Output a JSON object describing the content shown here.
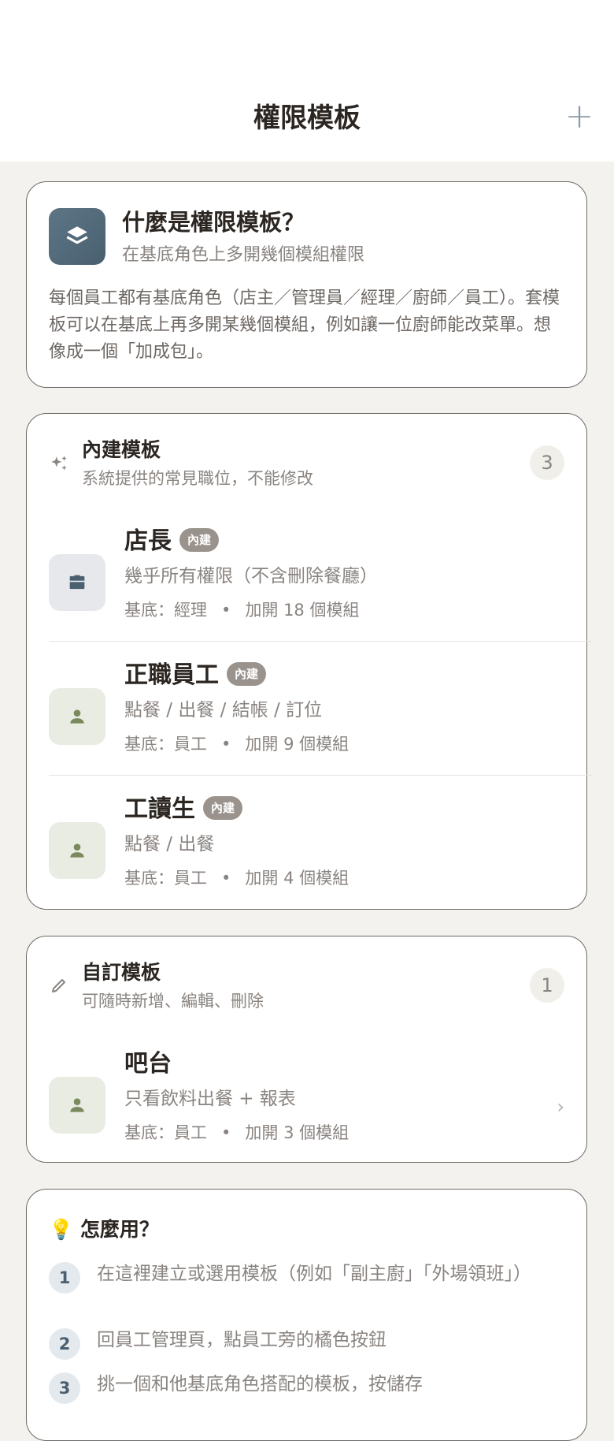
{
  "header": {
    "title": "權限模板",
    "add_icon": "plus-icon"
  },
  "intro": {
    "icon": "layers-icon",
    "title": "什麼是權限模板？",
    "subtitle": "在基底角色上多開幾個模組權限",
    "body": "每個員工都有基底角色（店主／管理員／經理／廚師／員工）。套模板可以在基底上再多開某幾個模組，例如讓一位廚師能改菜單。想像成一個「加成包」。"
  },
  "builtin": {
    "icon": "sparkle-icon",
    "title": "內建模板",
    "subtitle": "系統提供的常見職位，不能修改",
    "count": "3",
    "items": [
      {
        "icon": "briefcase-icon",
        "name": "店長",
        "badge": "內建",
        "desc": "幾乎所有權限（不含刪除餐廳）",
        "base": "基底：經理",
        "dot": "•",
        "extra": "加開 18 個模組"
      },
      {
        "icon": "person-icon",
        "name": "正職員工",
        "badge": "內建",
        "desc": "點餐 / 出餐 / 結帳 / 訂位",
        "base": "基底：員工",
        "dot": "•",
        "extra": "加開 9 個模組"
      },
      {
        "icon": "person-icon",
        "name": "工讀生",
        "badge": "內建",
        "desc": "點餐 / 出餐",
        "base": "基底：員工",
        "dot": "•",
        "extra": "加開 4 個模組"
      }
    ]
  },
  "custom": {
    "icon": "pencil-icon",
    "title": "自訂模板",
    "subtitle": "可隨時新增、編輯、刪除",
    "count": "1",
    "items": [
      {
        "icon": "person-icon",
        "name": "吧台",
        "desc": "只看飲料出餐 + 報表",
        "base": "基底：員工",
        "dot": "•",
        "extra": "加開 3 個模組",
        "chevron": "›"
      }
    ]
  },
  "howto": {
    "title": "💡 怎麼用？",
    "steps": [
      {
        "num": "1",
        "text": "在這裡建立或選用模板（例如「副主廚」「外場領班」）"
      },
      {
        "num": "2",
        "text": "回員工管理頁，點員工旁的橘色按鈕"
      },
      {
        "num": "3",
        "text": "挑一個和他基底角色搭配的模板，按儲存"
      }
    ]
  },
  "colors": {
    "accent": "#4a6070",
    "badge": "#9a938d",
    "person_icon": "#7a8a5c",
    "background": "#f3f2ee"
  }
}
